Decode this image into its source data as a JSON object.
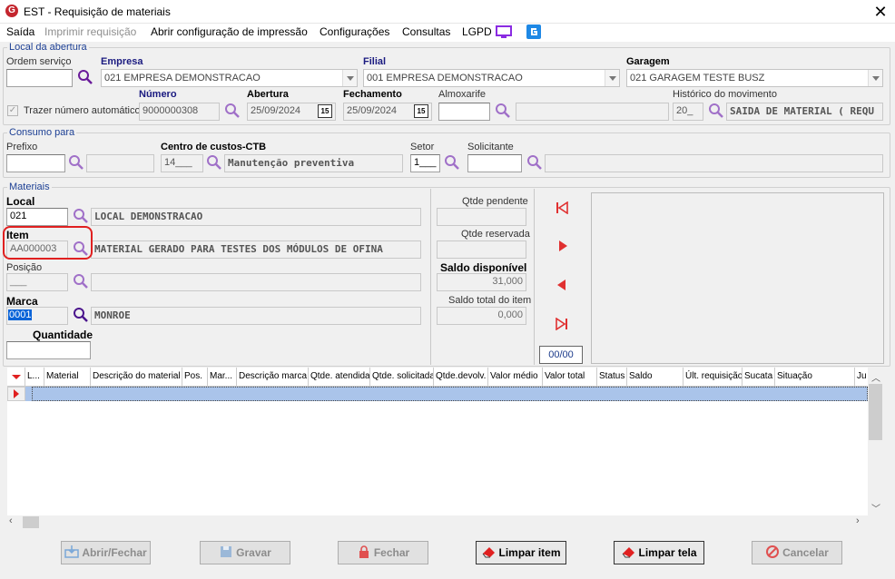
{
  "window": {
    "title": "EST - Requisição de materiais",
    "logo_letter": "G"
  },
  "menu": [
    {
      "label": "Saída",
      "enabled": true
    },
    {
      "label": "Imprimir requisição",
      "enabled": false
    },
    {
      "label": "Abrir configuração de impressão",
      "enabled": true
    },
    {
      "label": "Configurações",
      "enabled": true
    },
    {
      "label": "Consultas",
      "enabled": true
    },
    {
      "label": "LGPD",
      "enabled": true
    }
  ],
  "abertura": {
    "legend": "Local da abertura",
    "ordem_servico": {
      "label": "Ordem serviço",
      "value": ""
    },
    "empresa": {
      "label": "Empresa",
      "value": "021 EMPRESA DEMONSTRACAO"
    },
    "filial": {
      "label": "Filial",
      "value": "001 EMPRESA DEMONSTRACAO"
    },
    "garagem": {
      "label": "Garagem",
      "value": "021 GARAGEM TESTE BUSZ"
    },
    "trazer_numero": {
      "label": "Trazer número automático",
      "checked": true
    },
    "numero": {
      "label": "Número",
      "value": "9000000308"
    },
    "abertura": {
      "label": "Abertura",
      "value": "25/09/2024",
      "cal": "15"
    },
    "fechamento": {
      "label": "Fechamento",
      "value": "25/09/2024",
      "cal": "15"
    },
    "almoxarife": {
      "label": "Almoxarife",
      "value": "",
      "desc": ""
    },
    "historico": {
      "label": "Histórico do movimento",
      "code": "20_",
      "desc": "SAIDA DE MATERIAL ( REQU"
    }
  },
  "consumo": {
    "legend": "Consumo para",
    "prefixo": {
      "label": "Prefixo",
      "value": "",
      "desc": ""
    },
    "centro": {
      "label": "Centro de custos-CTB",
      "code": "14___",
      "desc": "Manutenção preventiva"
    },
    "setor": {
      "label": "Setor",
      "value": "1___"
    },
    "solicitante": {
      "label": "Solicitante",
      "value": "",
      "desc": ""
    }
  },
  "materiais": {
    "legend": "Materiais",
    "local": {
      "label": "Local",
      "code": "021",
      "desc": "LOCAL DEMONSTRACAO"
    },
    "item": {
      "label": "Item",
      "code": "AA000003",
      "desc": "MATERIAL GERADO PARA TESTES DOS MÓDULOS DE OFINA"
    },
    "posicao": {
      "label": "Posição",
      "code": "___",
      "desc": ""
    },
    "marca": {
      "label": "Marca",
      "code": "0001",
      "desc": "MONROE"
    },
    "quantidade": {
      "label": "Quantidade",
      "value": ""
    },
    "qtde_pendente": {
      "label": "Qtde pendente",
      "value": ""
    },
    "qtde_reservada": {
      "label": "Qtde reservada",
      "value": ""
    },
    "saldo_disponivel": {
      "label": "Saldo disponível",
      "value": "31,000"
    },
    "saldo_total": {
      "label": "Saldo total do item",
      "value": "0,000"
    },
    "pager": "00/00"
  },
  "grid": {
    "columns": [
      "L...",
      "Material",
      "Descrição do material",
      "Pos.",
      "Mar...",
      "Descrição marca",
      "Qtde. atendida",
      "Qtde. solicitada",
      "Qtde.devolv.",
      "Valor médio",
      "Valor total",
      "Status",
      "Saldo",
      "Últ. requisição",
      "Sucata",
      "Situação",
      "Ju"
    ]
  },
  "buttons": {
    "abrir_fechar": "Abrir/Fechar",
    "gravar": "Gravar",
    "fechar": "Fechar",
    "limpar_item": "Limpar item",
    "limpar_tela": "Limpar tela",
    "cancelar": "Cancelar"
  },
  "colors": {
    "accent_purple": "#8a2be2",
    "highlight_red": "#e02020",
    "nav_red": "#e03030"
  }
}
